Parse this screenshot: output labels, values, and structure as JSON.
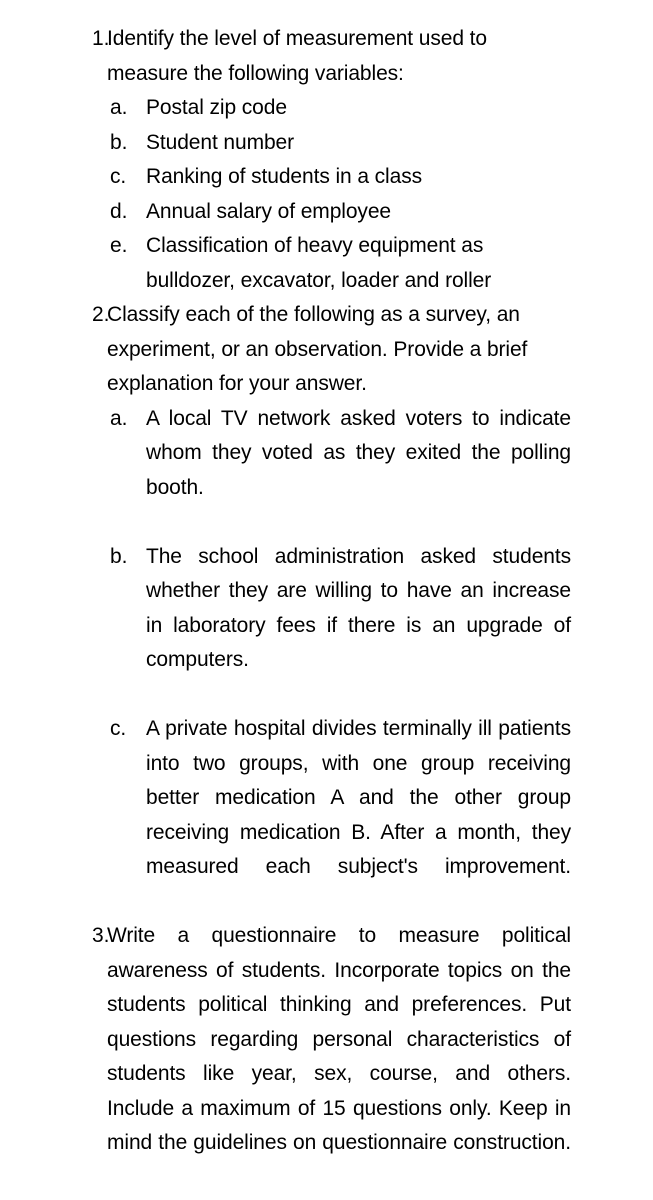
{
  "document": {
    "type": "worksheet",
    "background_color": "#ffffff",
    "text_color": "#000000",
    "questions": [
      {
        "marker": "1.",
        "text": "Identify the level of measurement used to measure the following variables:",
        "align": "left",
        "subitems": [
          {
            "marker": "a.",
            "text": "Postal zip code",
            "align": "left"
          },
          {
            "marker": "b.",
            "text": "Student number",
            "align": "left"
          },
          {
            "marker": "c.",
            "text": "Ranking of students in a class",
            "align": "left"
          },
          {
            "marker": "d.",
            "text": "Annual salary of employee",
            "align": "left"
          },
          {
            "marker": "e.",
            "text": "Classification of heavy equipment as bulldozer, excavator, loader and roller",
            "align": "left"
          }
        ]
      },
      {
        "marker": "2.",
        "text": "Classify each of the following as a survey, an experiment, or an observation. Provide a brief explanation for your answer.",
        "align": "left",
        "subitems": [
          {
            "marker": "a.",
            "text": "A local TV network asked voters to indicate whom they voted as they exited the polling booth.",
            "align": "justify"
          },
          {
            "marker": "b.",
            "text": "The school administration asked students whether they are willing to have an increase in laboratory fees if there is an upgrade of computers.",
            "align": "justify"
          },
          {
            "marker": "c.",
            "text": "A private hospital divides terminally ill patients into two groups, with one group receiving better medication A and the other group receiving medication B. After a month, they measured each subject's improvement.",
            "align": "justify"
          }
        ]
      },
      {
        "marker": "3.",
        "text": "Write a questionnaire to measure political awareness of students. Incorporate topics on the students political thinking and preferences. Put questions regarding personal characteristics of students like year, sex, course, and others. Include a maximum of 15 questions only. Keep in mind the guidelines on questionnaire construction.",
        "align": "justify",
        "subitems": []
      }
    ]
  }
}
